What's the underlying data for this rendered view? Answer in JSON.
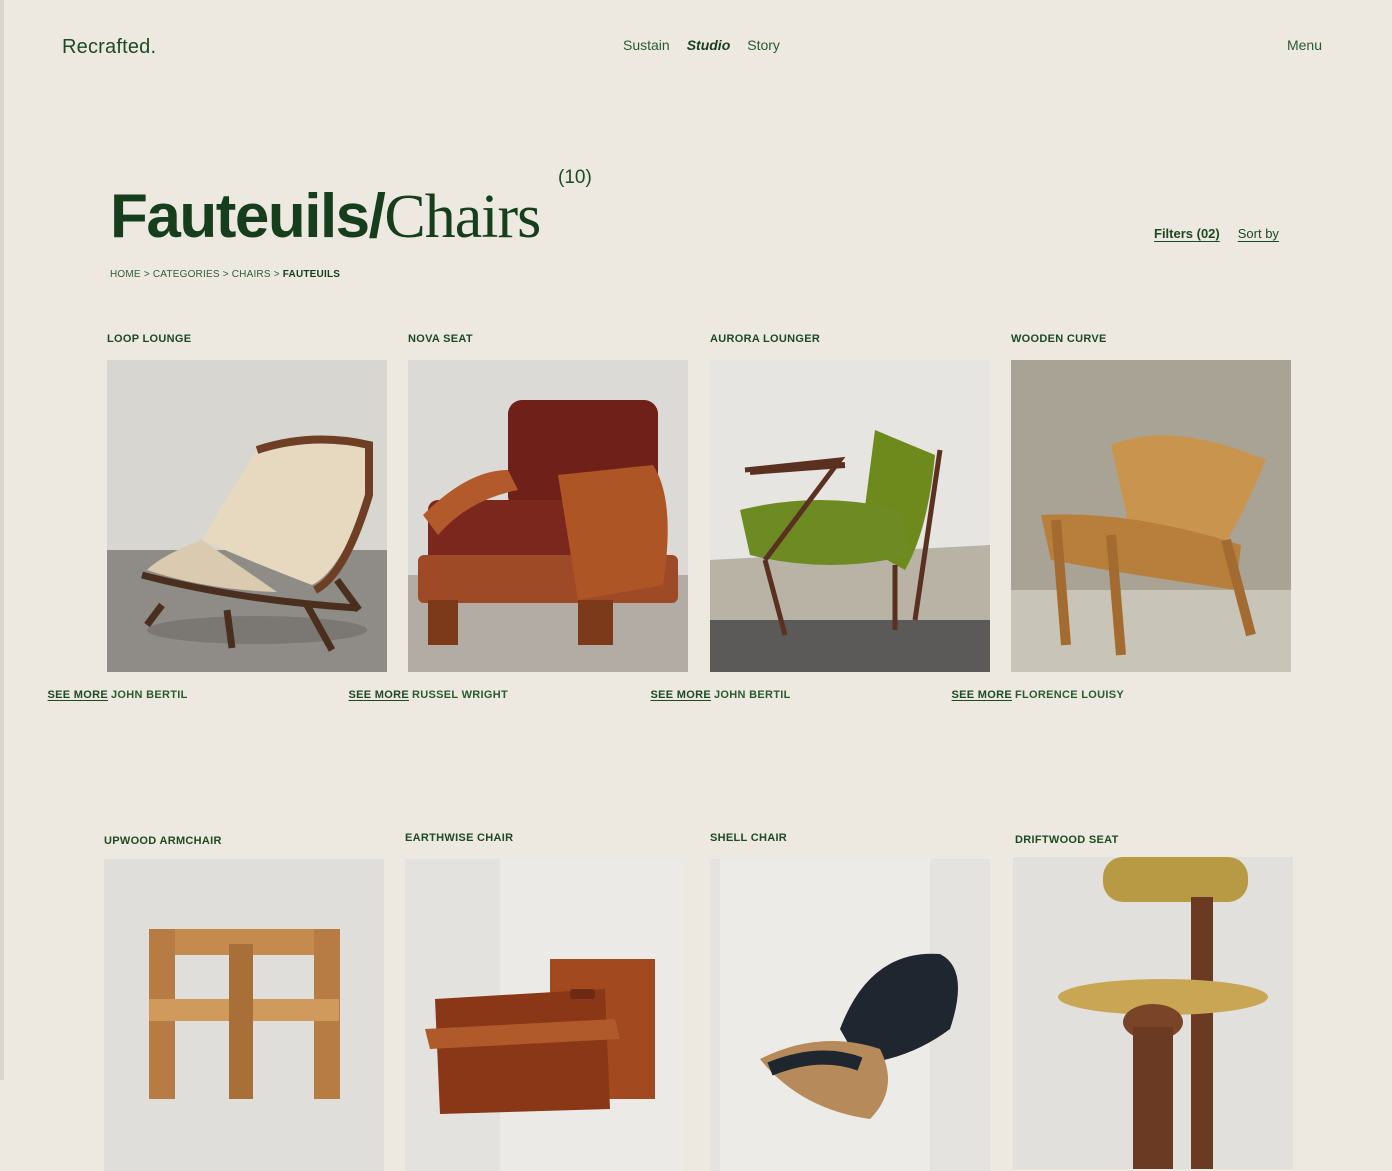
{
  "header": {
    "brand": "Recrafted.",
    "nav": [
      "Sustain",
      "Studio",
      "Story"
    ],
    "menu": "Menu"
  },
  "page": {
    "title_bold": "Fauteuils/",
    "title_serif": "Chairs",
    "count": "(10)",
    "breadcrumb": [
      "HOME",
      ">",
      "CATEGORIES",
      ">",
      "CHAIRS",
      ">",
      "FAUTEUILS"
    ],
    "filters": "Filters (02)",
    "sort": "Sort by"
  },
  "products": [
    {
      "name": "LOOP LOUNGE",
      "author": "JOHN BERTIL",
      "more": "SEE MORE"
    },
    {
      "name": "NOVA SEAT",
      "author": "RUSSEL WRIGHT",
      "more": "SEE MORE"
    },
    {
      "name": "AURORA LOUNGER",
      "author": "JOHN BERTIL",
      "more": "SEE MORE"
    },
    {
      "name": "WOODEN CURVE",
      "author": "FLORENCE LOUISY",
      "more": "SEE MORE"
    },
    {
      "name": "UPWOOD ARMCHAIR"
    },
    {
      "name": "EARTHWISE CHAIR"
    },
    {
      "name": "SHELL CHAIR"
    },
    {
      "name": "DRIFTWOOD SEAT"
    }
  ]
}
